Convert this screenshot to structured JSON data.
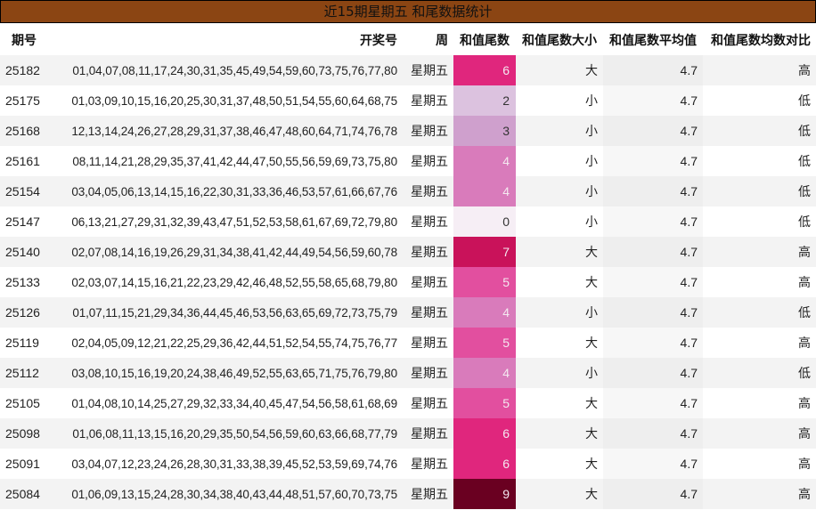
{
  "title": "近15期星期五 和尾数据统计",
  "headers": {
    "issue": "期号",
    "draw": "开奖号",
    "weekday": "周",
    "tail": "和值尾数",
    "size": "和值尾数大小",
    "avg": "和值尾数平均值",
    "cmp": "和值尾数均数对比"
  },
  "colors": {
    "title_bg": "#8b4513",
    "tail_scale": {
      "0": "#f6eef5",
      "2": "#dcc2df",
      "3": "#cfa0cd",
      "4": "#d97bbb",
      "5": "#e24f9f",
      "6": "#e0267d",
      "7": "#c9125a",
      "9": "#6a0021"
    }
  },
  "rows": [
    {
      "issue": "25182",
      "draw": "01,04,07,08,11,17,24,30,31,35,45,49,54,59,60,73,75,76,77,80",
      "weekday": "星期五",
      "tail": "6",
      "size": "大",
      "avg": "4.7",
      "cmp": "高"
    },
    {
      "issue": "25175",
      "draw": "01,03,09,10,15,16,20,25,30,31,37,48,50,51,54,55,60,64,68,75",
      "weekday": "星期五",
      "tail": "2",
      "size": "小",
      "avg": "4.7",
      "cmp": "低"
    },
    {
      "issue": "25168",
      "draw": "12,13,14,24,26,27,28,29,31,37,38,46,47,48,60,64,71,74,76,78",
      "weekday": "星期五",
      "tail": "3",
      "size": "小",
      "avg": "4.7",
      "cmp": "低"
    },
    {
      "issue": "25161",
      "draw": "08,11,14,21,28,29,35,37,41,42,44,47,50,55,56,59,69,73,75,80",
      "weekday": "星期五",
      "tail": "4",
      "size": "小",
      "avg": "4.7",
      "cmp": "低"
    },
    {
      "issue": "25154",
      "draw": "03,04,05,06,13,14,15,16,22,30,31,33,36,46,53,57,61,66,67,76",
      "weekday": "星期五",
      "tail": "4",
      "size": "小",
      "avg": "4.7",
      "cmp": "低"
    },
    {
      "issue": "25147",
      "draw": "06,13,21,27,29,31,32,39,43,47,51,52,53,58,61,67,69,72,79,80",
      "weekday": "星期五",
      "tail": "0",
      "size": "小",
      "avg": "4.7",
      "cmp": "低"
    },
    {
      "issue": "25140",
      "draw": "02,07,08,14,16,19,26,29,31,34,38,41,42,44,49,54,56,59,60,78",
      "weekday": "星期五",
      "tail": "7",
      "size": "大",
      "avg": "4.7",
      "cmp": "高"
    },
    {
      "issue": "25133",
      "draw": "02,03,07,14,15,16,21,22,23,29,42,46,48,52,55,58,65,68,79,80",
      "weekday": "星期五",
      "tail": "5",
      "size": "大",
      "avg": "4.7",
      "cmp": "高"
    },
    {
      "issue": "25126",
      "draw": "01,07,11,15,21,29,34,36,44,45,46,53,56,63,65,69,72,73,75,79",
      "weekday": "星期五",
      "tail": "4",
      "size": "小",
      "avg": "4.7",
      "cmp": "低"
    },
    {
      "issue": "25119",
      "draw": "02,04,05,09,12,21,22,25,29,36,42,44,51,52,54,55,74,75,76,77",
      "weekday": "星期五",
      "tail": "5",
      "size": "大",
      "avg": "4.7",
      "cmp": "高"
    },
    {
      "issue": "25112",
      "draw": "03,08,10,15,16,19,20,24,38,46,49,52,55,63,65,71,75,76,79,80",
      "weekday": "星期五",
      "tail": "4",
      "size": "小",
      "avg": "4.7",
      "cmp": "低"
    },
    {
      "issue": "25105",
      "draw": "01,04,08,10,14,25,27,29,32,33,34,40,45,47,54,56,58,61,68,69",
      "weekday": "星期五",
      "tail": "5",
      "size": "大",
      "avg": "4.7",
      "cmp": "高"
    },
    {
      "issue": "25098",
      "draw": "01,06,08,11,13,15,16,20,29,35,50,54,56,59,60,63,66,68,77,79",
      "weekday": "星期五",
      "tail": "6",
      "size": "大",
      "avg": "4.7",
      "cmp": "高"
    },
    {
      "issue": "25091",
      "draw": "03,04,07,12,23,24,26,28,30,31,33,38,39,45,52,53,59,69,74,76",
      "weekday": "星期五",
      "tail": "6",
      "size": "大",
      "avg": "4.7",
      "cmp": "高"
    },
    {
      "issue": "25084",
      "draw": "01,06,09,13,15,24,28,30,34,38,40,43,44,48,51,57,60,70,73,75",
      "weekday": "星期五",
      "tail": "9",
      "size": "大",
      "avg": "4.7",
      "cmp": "高"
    }
  ]
}
